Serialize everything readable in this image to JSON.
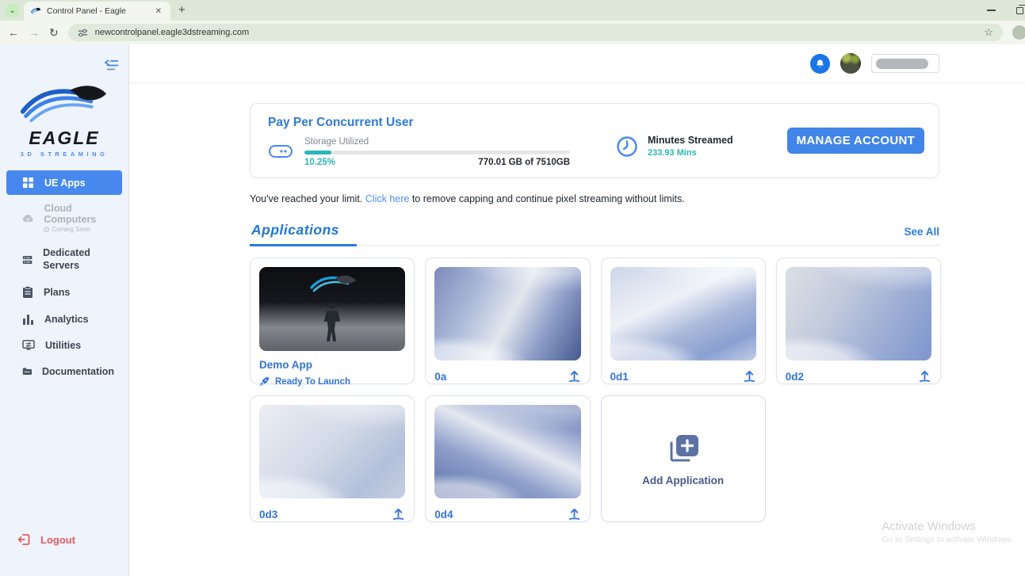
{
  "browser": {
    "tab_title": "Control Panel - Eagle",
    "url": "newcontrolpanel.eagle3dstreaming.com"
  },
  "sidebar": {
    "brand": {
      "name": "EAGLE",
      "tagline": "3D STREAMING"
    },
    "items": [
      {
        "label": "UE Apps"
      },
      {
        "label": "Cloud Computers",
        "sublabel": "Coming Soon"
      },
      {
        "label": "Dedicated Servers"
      },
      {
        "label": "Plans"
      },
      {
        "label": "Analytics"
      },
      {
        "label": "Utilities"
      },
      {
        "label": "Documentation"
      }
    ],
    "logout_label": "Logout"
  },
  "billing": {
    "plan_title": "Pay Per Concurrent User",
    "storage": {
      "label": "Storage Utilized",
      "percent": "10.25%",
      "percent_value": 10.25,
      "usage": "770.01 GB of 7510GB"
    },
    "minutes": {
      "label": "Minutes Streamed",
      "value": "233.93 Mins"
    },
    "manage_button": "MANAGE ACCOUNT"
  },
  "limit_notice": {
    "before": "You've reached your limit. ",
    "link": "Click here",
    "after": " to remove capping and continue pixel streaming without limits."
  },
  "applications": {
    "title": "Applications",
    "see_all": "See All",
    "cards": [
      {
        "name": "Demo App",
        "status": "Ready To Launch"
      },
      {
        "name": "0a"
      },
      {
        "name": "0d1"
      },
      {
        "name": "0d2"
      },
      {
        "name": "0d3"
      },
      {
        "name": "0d4"
      }
    ],
    "add_label": "Add Application"
  },
  "watermark": {
    "line1": "Activate Windows",
    "line2": "Go to Settings to activate Windows."
  },
  "colors": {
    "accent_blue": "#4788ee",
    "teal": "#2cb5b8",
    "logout_red": "#e25d5d"
  }
}
